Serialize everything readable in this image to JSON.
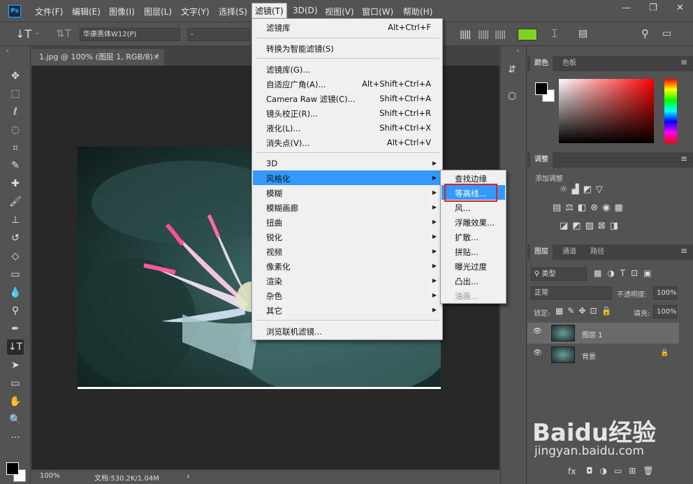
{
  "app": {
    "logo": "Ps"
  },
  "menubar": {
    "items": [
      "文件(F)",
      "编辑(E)",
      "图像(I)",
      "图层(L)",
      "文字(Y)",
      "选择(S)",
      "滤镜(T)",
      "3D(D)",
      "视图(V)",
      "窗口(W)",
      "帮助(H)"
    ],
    "active": "滤镜(T)"
  },
  "window": {
    "minimize": "—",
    "maximize": "❐",
    "close": "✕"
  },
  "options": {
    "font_family": "华康黑体W12(P)",
    "font_style": "-"
  },
  "document": {
    "tab": "1.jpg @ 100% (图层 1, RGB/8) *",
    "close": "×"
  },
  "status": {
    "zoom": "100%",
    "doc_info": "文档:530.2K/1.04M",
    "arrow": "›"
  },
  "filter_menu": {
    "items": [
      {
        "label": "滤镜库",
        "key": "Alt+Ctrl+F"
      },
      {
        "label": "转换为智能滤镜(S)",
        "key": ""
      },
      {
        "label": "滤镜库(G)...",
        "key": ""
      },
      {
        "label": "自适应广角(A)...",
        "key": "Alt+Shift+Ctrl+A"
      },
      {
        "label": "Camera Raw 滤镜(C)...",
        "key": "Shift+Ctrl+A"
      },
      {
        "label": "镜头校正(R)...",
        "key": "Shift+Ctrl+R"
      },
      {
        "label": "液化(L)...",
        "key": "Shift+Ctrl+X"
      },
      {
        "label": "消失点(V)...",
        "key": "Alt+Ctrl+V"
      },
      {
        "label": "3D",
        "key": ""
      },
      {
        "label": "风格化",
        "key": ""
      },
      {
        "label": "模糊",
        "key": ""
      },
      {
        "label": "模糊画廊",
        "key": ""
      },
      {
        "label": "扭曲",
        "key": ""
      },
      {
        "label": "锐化",
        "key": ""
      },
      {
        "label": "视频",
        "key": ""
      },
      {
        "label": "像素化",
        "key": ""
      },
      {
        "label": "渲染",
        "key": ""
      },
      {
        "label": "杂色",
        "key": ""
      },
      {
        "label": "其它",
        "key": ""
      },
      {
        "label": "浏览联机滤镜...",
        "key": ""
      }
    ],
    "highlighted": "风格化"
  },
  "stylize_submenu": {
    "items": [
      "查找边缘",
      "等高线...",
      "风...",
      "浮雕效果...",
      "扩散...",
      "拼贴...",
      "曝光过度",
      "凸出...",
      "油画..."
    ],
    "highlighted": "等高线...",
    "disabled": "油画..."
  },
  "color_panel": {
    "tabs": [
      "颜色",
      "色板"
    ],
    "foreground": "#000000",
    "background": "#ffffff"
  },
  "adjust_panel": {
    "tab": "调整",
    "label": "添加调整"
  },
  "layers_panel": {
    "tabs": [
      "图层",
      "通道",
      "路径"
    ],
    "filter": "类型",
    "blend": "正常",
    "opacity_label": "不透明度:",
    "opacity": "100%",
    "lock_label": "锁定:",
    "fill_label": "填充:",
    "fill": "100%",
    "layers": [
      {
        "name": "图层 1"
      },
      {
        "name": "背景"
      }
    ],
    "fx": "fx"
  },
  "watermark": {
    "brand": "Baidu经验",
    "url": "jingyan.baidu.com"
  },
  "colors": {
    "menu_highlight": "#3399ff",
    "ui_bg": "#535353",
    "accent_green": "#7ed321",
    "callout_red": "#e02020"
  }
}
